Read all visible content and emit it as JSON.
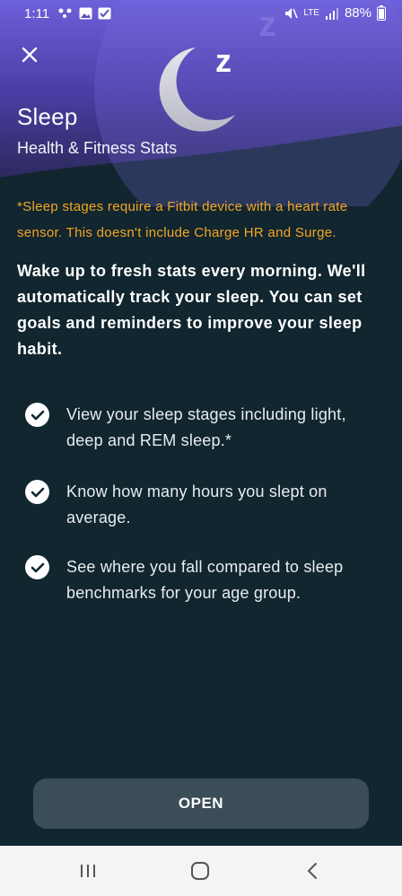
{
  "status_bar": {
    "time": "1:11",
    "network": "LTE",
    "battery": "88%"
  },
  "header": {
    "title": "Sleep",
    "subtitle": "Health & Fitness Stats"
  },
  "notice": "*Sleep stages require a Fitbit device with a heart rate sensor. This doesn't include Charge HR and Surge.",
  "intro": "Wake up to fresh stats every morning. We'll automatically track your sleep. You can set goals and reminders to improve your sleep habit.",
  "features": [
    "View your sleep stages including light, deep and REM sleep.*",
    "Know how many hours you slept on average.",
    "See where you fall compared to sleep benchmarks for your age group."
  ],
  "open_button": "OPEN",
  "colors": {
    "background": "#11262f",
    "header_purple": "#6f63d8",
    "notice": "#f5a623",
    "button": "#3b4d56"
  }
}
